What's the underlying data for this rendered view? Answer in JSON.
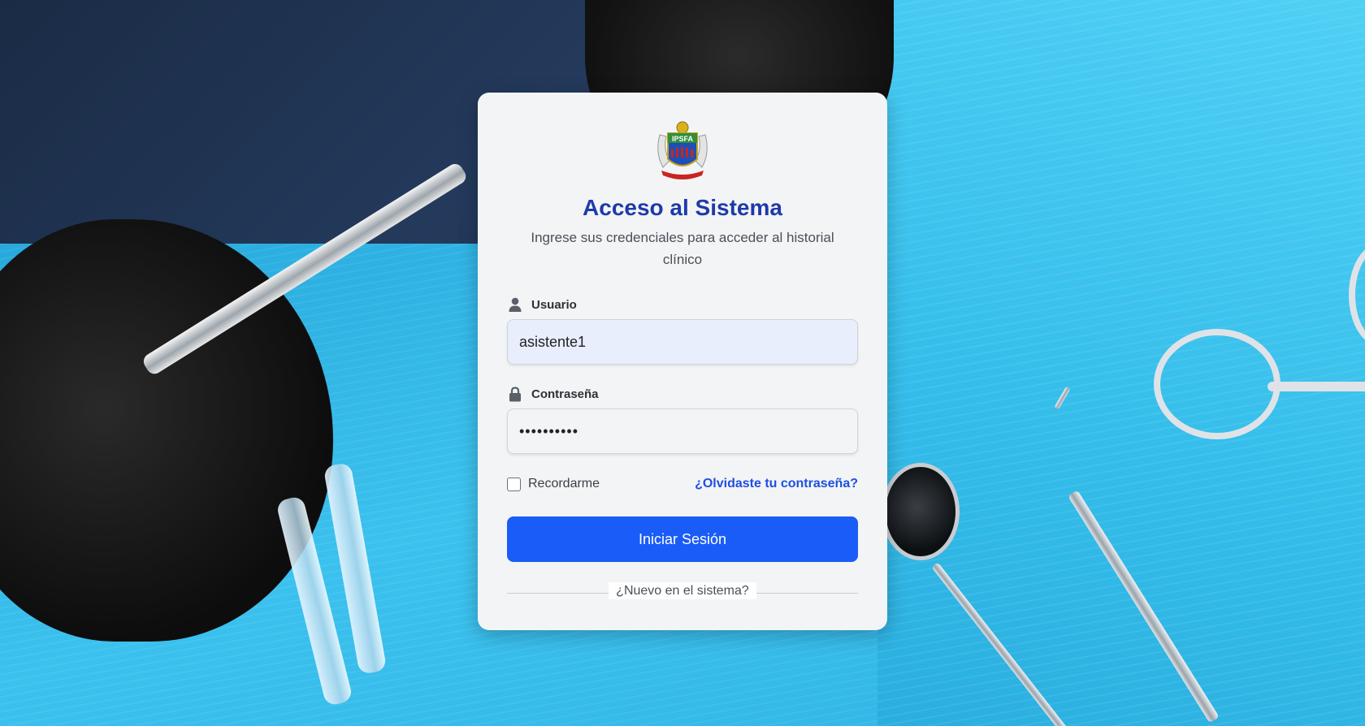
{
  "login": {
    "title": "Acceso al Sistema",
    "subtitle": "Ingrese sus credenciales para acceder al historial clínico",
    "logo_text": "IPSFA",
    "username_label": "Usuario",
    "username_value": "asistente1",
    "password_label": "Contraseña",
    "password_value": "••••••••••",
    "remember_label": "Recordarme",
    "remember_checked": false,
    "forgot_link": "¿Olvidaste tu contraseña?",
    "submit_label": "Iniciar Sesión",
    "signup_prompt": "¿Nuevo en el sistema?"
  },
  "colors": {
    "title": "#1e3aa8",
    "accent_button": "#1a5cf7",
    "link": "#1f4fe0",
    "card_bg": "#f3f4f6"
  },
  "icons": {
    "username": "user-icon",
    "password": "lock-icon"
  }
}
